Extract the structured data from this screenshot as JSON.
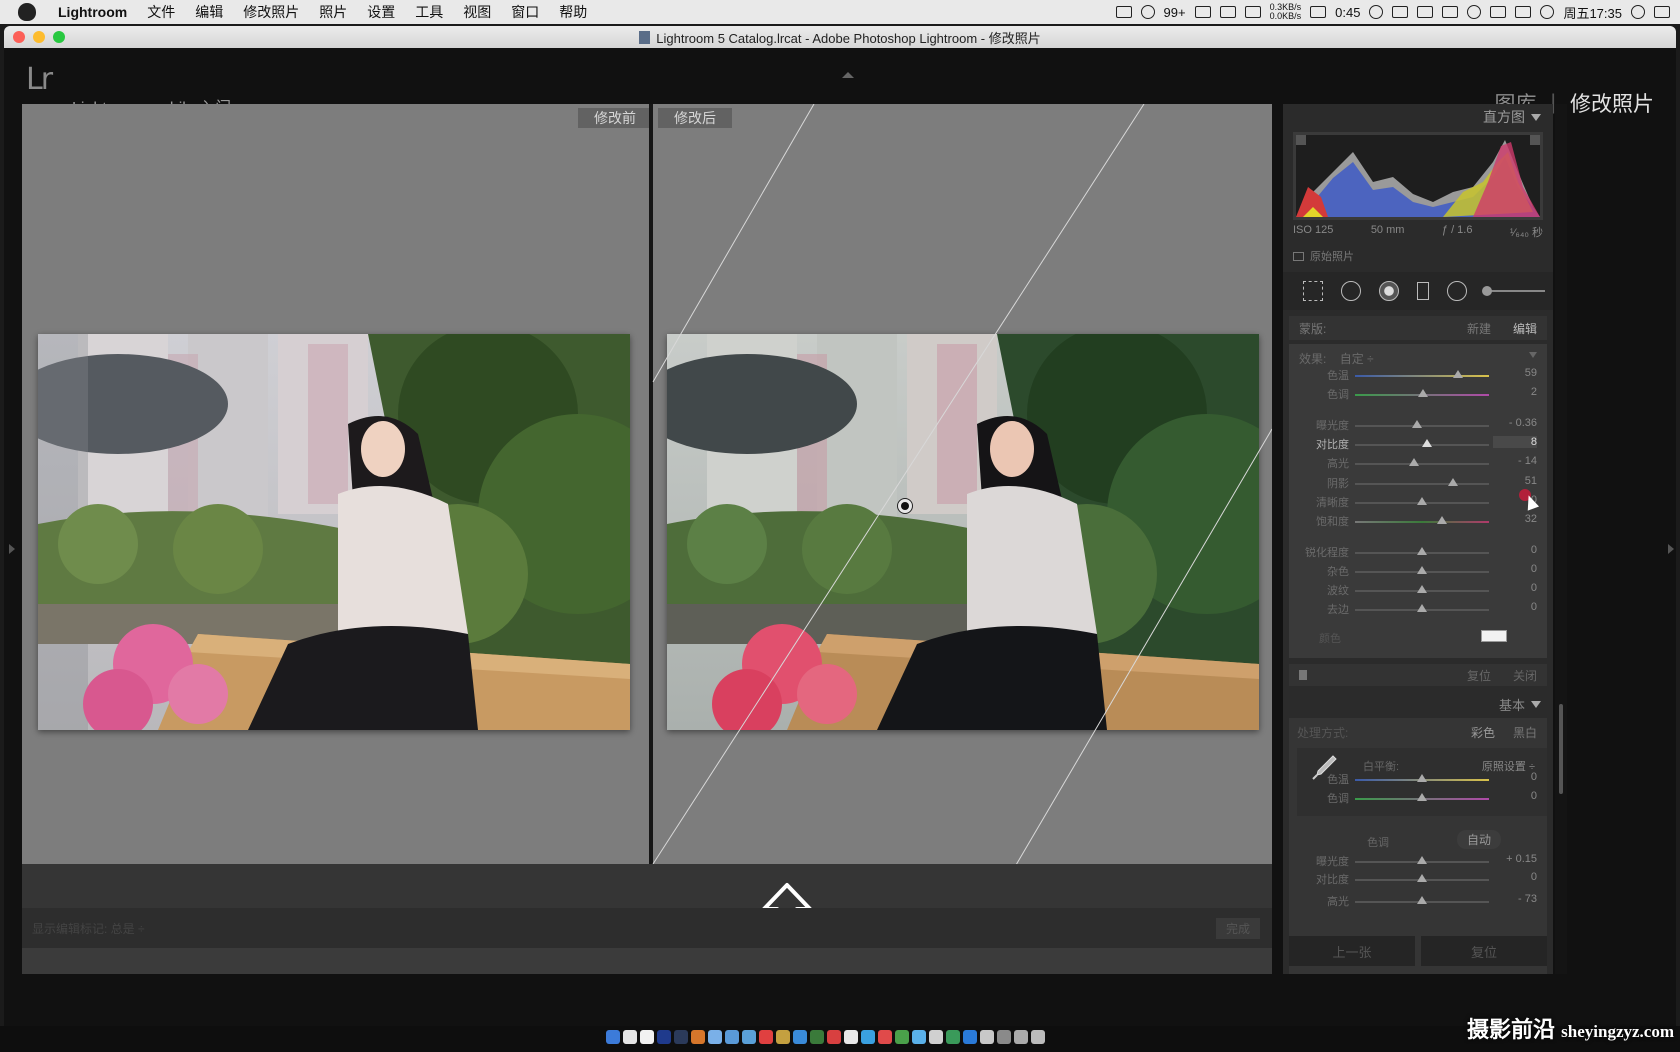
{
  "menubar": {
    "app": "Lightroom",
    "items": [
      "文件",
      "编辑",
      "修改照片",
      "照片",
      "设置",
      "工具",
      "视图",
      "窗口",
      "帮助"
    ],
    "status": {
      "badge": "99+",
      "net_up": "0.3KB/s",
      "net_down": "0.0KB/s",
      "battery_time": "0:45",
      "clock": "周五17:35"
    }
  },
  "window": {
    "title": "Lightroom 5 Catalog.lrcat - Adobe Photoshop Lightroom - 修改照片"
  },
  "header": {
    "logo": "Lr",
    "mobile": "Lightroom mobile 入门",
    "mobile_arrow": "▶",
    "module_library": "图库",
    "module_sep": "|",
    "module_develop": "修改照片"
  },
  "view": {
    "before_label": "修改前",
    "after_label": "修改后",
    "toolbar_label": "显示编辑标记: 总是 ÷",
    "finish_label": "完成"
  },
  "panel": {
    "histogram_title": "直方图",
    "exif": {
      "iso": "ISO 125",
      "focal": "50 mm",
      "aperture": "ƒ / 1.6",
      "shutter": "¹⁄₆₄₀ 秒"
    },
    "original_photo": "原始照片",
    "mask": {
      "label": "蒙版:",
      "new": "新建",
      "edit": "编辑"
    },
    "effect": {
      "label": "效果:",
      "value": "自定 ÷"
    },
    "sliders": [
      {
        "label": "色温",
        "value": "59",
        "pos": 0.77,
        "active": false
      },
      {
        "label": "色调",
        "value": "2",
        "pos": 0.51,
        "active": false
      },
      {
        "label": "曝光度",
        "value": "- 0.36",
        "pos": 0.46,
        "active": false
      },
      {
        "label": "对比度",
        "value": "8",
        "pos": 0.54,
        "active": true
      },
      {
        "label": "高光",
        "value": "- 14",
        "pos": 0.44,
        "active": false
      },
      {
        "label": "阴影",
        "value": "51",
        "pos": 0.73,
        "active": false
      },
      {
        "label": "清晰度",
        "value": "0",
        "pos": 0.5,
        "active": false
      },
      {
        "label": "饱和度",
        "value": "32",
        "pos": 0.65,
        "active": false
      },
      {
        "label": "锐化程度",
        "value": "0",
        "pos": 0.5,
        "active": false
      },
      {
        "label": "杂色",
        "value": "0",
        "pos": 0.5,
        "active": false
      },
      {
        "label": "波纹",
        "value": "0",
        "pos": 0.5,
        "active": false
      },
      {
        "label": "去边",
        "value": "0",
        "pos": 0.5,
        "active": false
      }
    ],
    "color_label": "颜色",
    "mask_reset": "复位",
    "mask_close": "关闭",
    "basic_title": "基本",
    "treatment": {
      "label": "处理方式:",
      "color": "彩色",
      "bw": "黑白"
    },
    "wb": {
      "label": "白平衡:",
      "value": "原照设置 ÷"
    },
    "wb_sliders": [
      {
        "label": "色温",
        "value": "0"
      },
      {
        "label": "色调",
        "value": "0"
      }
    ],
    "tone": {
      "label": "色调",
      "auto": "自动"
    },
    "tone_sliders": [
      {
        "label": "曝光度",
        "value": "+ 0.15"
      },
      {
        "label": "对比度",
        "value": "0"
      },
      {
        "label": "高光",
        "value": "- 73"
      }
    ],
    "btn_prev": "上一张",
    "btn_reset": "复位"
  },
  "watermark": {
    "cn": "摄影前沿",
    "url": "sheyingzyz.com"
  }
}
